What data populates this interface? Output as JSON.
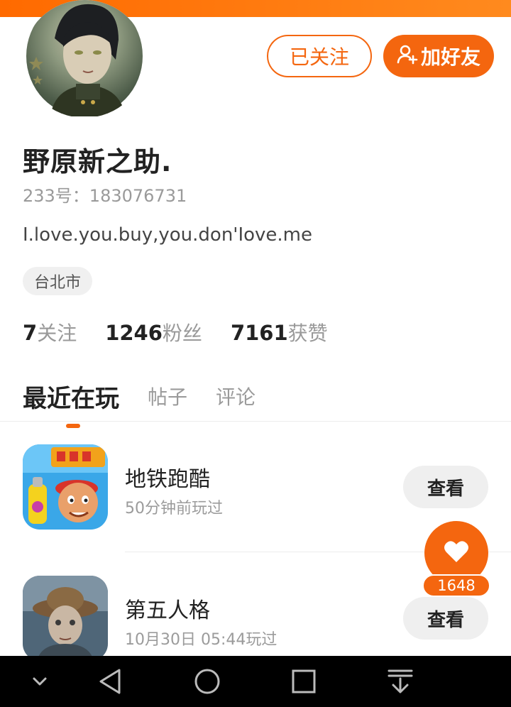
{
  "header": {
    "follow_status_label": "已关注",
    "add_friend_label": "加好友"
  },
  "profile": {
    "username": "野原新之助.",
    "account_id": "233号：183076731",
    "bio": "I.love.you.buy,you.don'Iove.me",
    "location": "台北市"
  },
  "stats": {
    "following_count": "7",
    "following_label": "关注",
    "followers_count": "1246",
    "followers_label": "粉丝",
    "likes_count": "7161",
    "likes_label": "获赞"
  },
  "tabs": [
    {
      "label": "最近在玩",
      "active": true
    },
    {
      "label": "帖子",
      "active": false
    },
    {
      "label": "评论",
      "active": false
    }
  ],
  "games": [
    {
      "name": "地铁跑酷",
      "last_played": "50分钟前玩过",
      "action_label": "查看",
      "icon": "subway-surfers-icon"
    },
    {
      "name": "第五人格",
      "last_played": "10月30日 05:44玩过",
      "action_label": "查看",
      "icon": "identity-v-icon"
    }
  ],
  "like_fab": {
    "count": "1648",
    "icon": "heart-icon"
  },
  "colors": {
    "accent": "#f4660f",
    "banner": "#ff7a10",
    "nav_bar": "#000000"
  }
}
